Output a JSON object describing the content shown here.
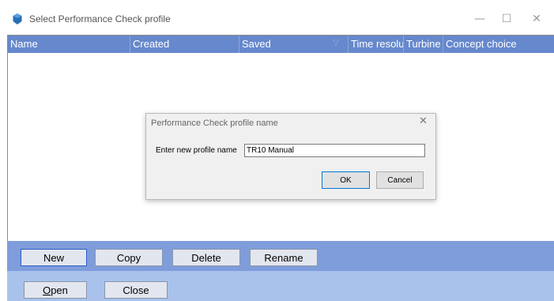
{
  "window": {
    "title": "Select Performance Check profile",
    "minimize_glyph": "—",
    "maximize_glyph": "☐",
    "close_glyph": "✕"
  },
  "table": {
    "columns": [
      "Name",
      "Created",
      "Saved",
      "Time resolution",
      "Turbine",
      "Concept choice"
    ],
    "sort_indicator": "▽",
    "rows": []
  },
  "buttons_row1": {
    "new": "New",
    "copy": "Copy",
    "delete": "Delete",
    "rename": "Rename"
  },
  "buttons_row2": {
    "open_prefix": "O",
    "open_rest": "pen",
    "close": "Close"
  },
  "dialog": {
    "title": "Performance Check profile name",
    "close_glyph": "✕",
    "label": "Enter new profile name",
    "input_value": "TR10 Manual",
    "ok": "OK",
    "cancel": "Cancel"
  },
  "colors": {
    "header_bg": "#6688cc",
    "bar1_bg": "#7f9ddb",
    "bar2_bg": "#a8c2ec"
  }
}
